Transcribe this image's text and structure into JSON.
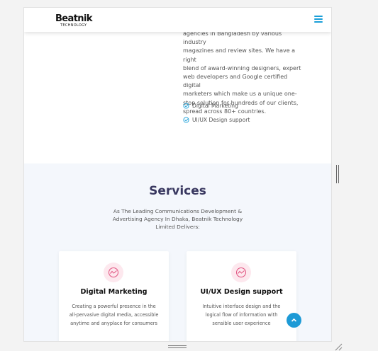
{
  "header": {
    "logo_main": "Beatnik",
    "logo_sub": "TECHNOLOGY",
    "menu_icon": "hamburger-menu-icon",
    "accent_color": "#1a9fd8"
  },
  "about": {
    "lines": [
      "agencies in Bangladesh by various industry",
      "magazines and review sites. We have a right",
      "blend of award-winning designers, expert",
      "web developers and Google certified digital",
      "marketers which make us a unique one-",
      "stop solution for hundreds of our clients,",
      "spread across 80+ countries."
    ],
    "features": [
      "Digital Marketing",
      "UI/UX Design support"
    ]
  },
  "services": {
    "title": "Services",
    "subtitle_lines": [
      "As The Leading Communications Development &",
      "Advertising Agency In Dhaka, Beatnik Technology",
      "Limited Delivers:"
    ],
    "cards": [
      {
        "title": "Digital Marketing",
        "desc_lines": [
          "Creating a powerful presence in the",
          "all-pervasive digital media, accessible",
          "anytime and anyplace for consumers"
        ],
        "icon": "chart-wave-icon"
      },
      {
        "title": "UI/UX Design support",
        "desc_lines": [
          "Intuitive interface design and the",
          "logical flow of information with",
          "sensible user experience"
        ],
        "icon": "chart-wave-icon"
      }
    ]
  },
  "scroll_top_icon": "arrow-up-icon",
  "colors": {
    "title": "#393860",
    "services_bg": "#f4f7fc",
    "icon_bg": "#fde8ee",
    "icon_stroke": "#e0517f",
    "scroll_button": "#1d9ad6"
  }
}
